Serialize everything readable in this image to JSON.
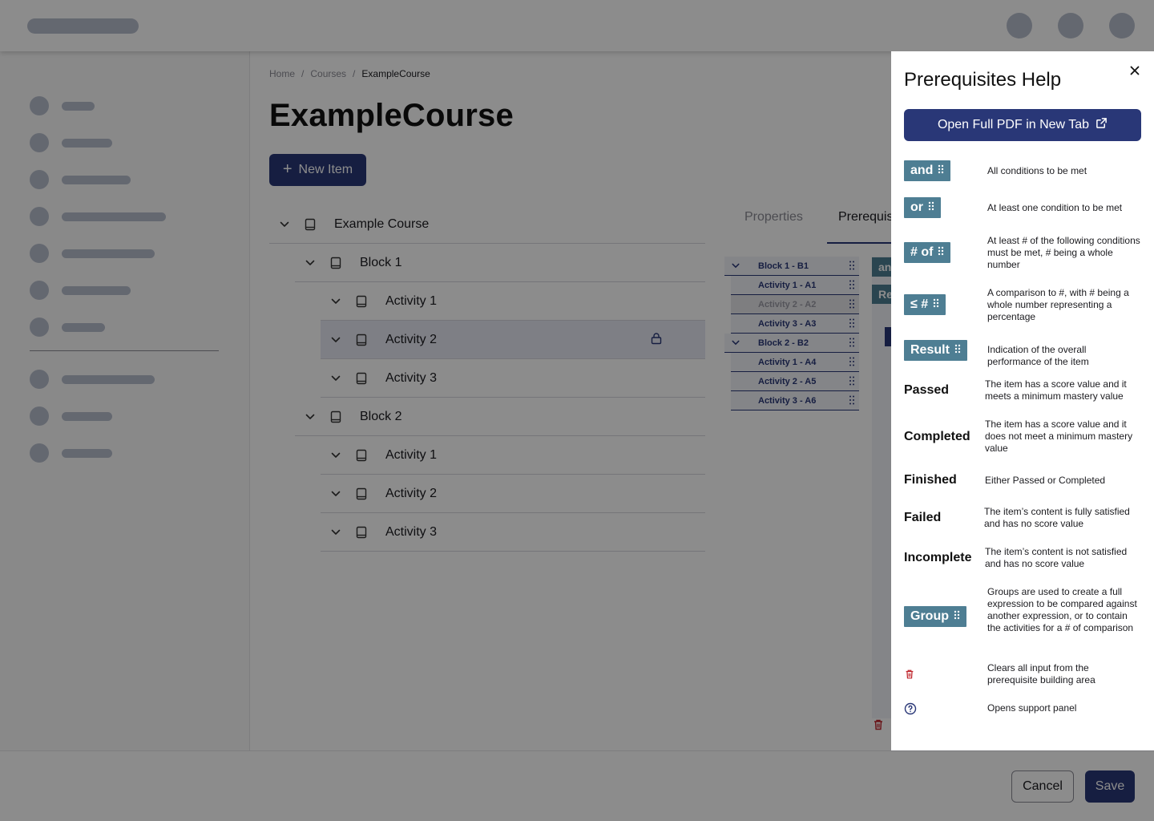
{
  "app": {
    "breadcrumb": [
      "Home",
      "Courses",
      "ExampleCourse"
    ],
    "page_title": "ExampleCourse",
    "new_item_label": "New Item"
  },
  "tree": {
    "items": [
      {
        "label": "Example Course",
        "level": 0
      },
      {
        "label": "Block 1",
        "level": 1
      },
      {
        "label": "Activity 1",
        "level": 2
      },
      {
        "label": "Activity 2",
        "level": 2,
        "selected": true,
        "locked": true
      },
      {
        "label": "Activity 3",
        "level": 2
      },
      {
        "label": "Block 2",
        "level": 1
      },
      {
        "label": "Activity 1",
        "level": 2
      },
      {
        "label": "Activity 2",
        "level": 2
      },
      {
        "label": "Activity 3",
        "level": 2
      }
    ]
  },
  "tabs": {
    "properties": "Properties",
    "prerequisites": "Prerequis"
  },
  "mini_list": [
    {
      "label": "Block 1 - B1",
      "type": "block"
    },
    {
      "label": "Activity 1 - A1",
      "type": "activity"
    },
    {
      "label": "Activity 2 - A2",
      "type": "activity",
      "disabled": true
    },
    {
      "label": "Activity 3 - A3",
      "type": "activity"
    },
    {
      "label": "Block 2 - B2",
      "type": "block"
    },
    {
      "label": "Activity 1 - A4",
      "type": "activity"
    },
    {
      "label": "Activity 2 - A5",
      "type": "activity"
    },
    {
      "label": "Activity 3 - A6",
      "type": "activity"
    }
  ],
  "build_area": {
    "chip_and": "an",
    "chip_result": "Re"
  },
  "footer": {
    "cancel_label": "Cancel",
    "save_label": "Save"
  },
  "help": {
    "title": "Prerequisites Help",
    "pdf_button": "Open Full PDF in New Tab",
    "entries": [
      {
        "term": "and",
        "kind": "chip",
        "desc": "All conditions to be met"
      },
      {
        "term": "or",
        "kind": "chip",
        "desc": "At least one condition to be met"
      },
      {
        "term": "# of",
        "kind": "chip",
        "desc": "At least # of the following conditions must be met, # being a whole number"
      },
      {
        "term": "≤ #",
        "kind": "chip",
        "desc": "A comparison to #, with # being a whole number representing a percentage"
      },
      {
        "term": "Result",
        "kind": "chip",
        "desc": "Indication of the overall performance of the item"
      },
      {
        "term": "Passed",
        "kind": "text",
        "desc": "The item has a score value and it meets a minimum mastery value"
      },
      {
        "term": "Completed",
        "kind": "text",
        "desc": "The item has a score value and it does not meet a minimum mastery value"
      },
      {
        "term": "Finished",
        "kind": "text",
        "desc": "Either Passed or Completed"
      },
      {
        "term": "Failed",
        "kind": "text",
        "desc": "The item’s content is fully satisfied and has no score value"
      },
      {
        "term": "Incomplete",
        "kind": "text",
        "desc": "The item’s content is not satisfied and has no score value"
      },
      {
        "term": "Group",
        "kind": "chip",
        "desc": "Groups are used to create a full expression to be compared against another expression, or to contain the activities for a # of comparison"
      },
      {
        "term": "",
        "kind": "icon",
        "icon": "trash-icon",
        "desc": "Clears all input from the prerequisite building area"
      },
      {
        "term": "",
        "kind": "icon",
        "icon": "help-circle-icon",
        "desc": "Opens support panel"
      }
    ]
  },
  "colors": {
    "primary": "#293777",
    "chip": "#4e7e93",
    "danger": "#c0262d",
    "placeholder": "#b7bdcc"
  }
}
